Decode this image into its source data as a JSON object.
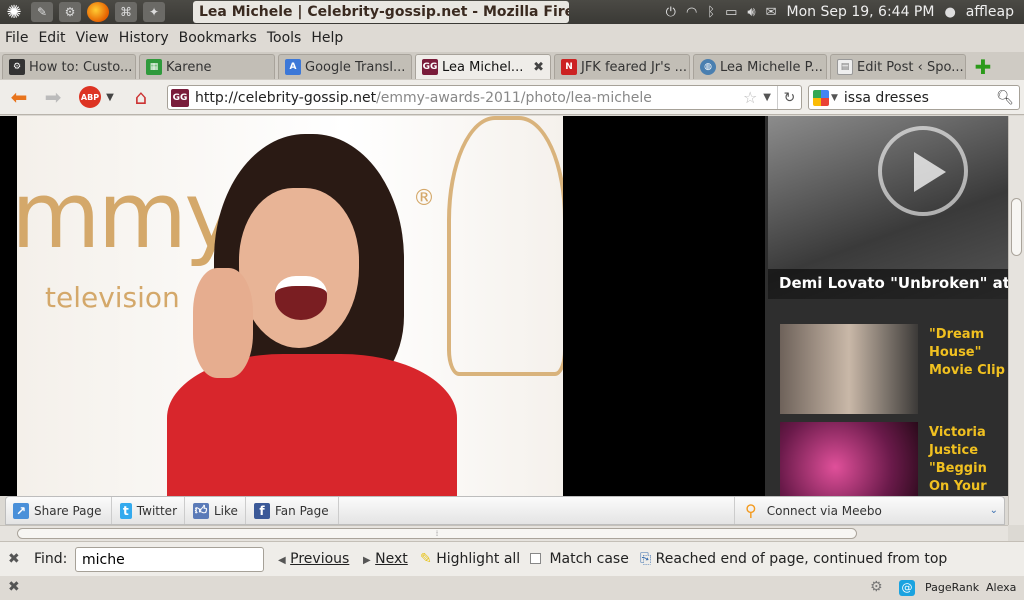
{
  "system": {
    "window_title": "Lea Michele | Celebrity-gossip.net - Mozilla Firefox",
    "clock": "Mon Sep 19,  6:44 PM",
    "user": "affleap"
  },
  "menu": [
    "File",
    "Edit",
    "View",
    "History",
    "Bookmarks",
    "Tools",
    "Help"
  ],
  "tabs": [
    {
      "label": "How to: Custo...",
      "fav": "gear-icon",
      "active": false
    },
    {
      "label": "Karene",
      "fav": "spreadsheet-icon",
      "active": false
    },
    {
      "label": "Google Transl...",
      "fav": "translate-icon",
      "active": false
    },
    {
      "label": "Lea Michel...",
      "fav": "gg-icon",
      "active": true
    },
    {
      "label": "JFK feared Jr's ...",
      "fav": "news-icon",
      "active": false
    },
    {
      "label": "Lea Michelle P...",
      "fav": "globe-icon",
      "active": false
    },
    {
      "label": "Edit Post ‹ Spo...",
      "fav": "page-icon",
      "active": false
    }
  ],
  "nav": {
    "url_host": "http://celebrity-gossip.net",
    "url_path": "/emmy-awards-2011/photo/lea-michele",
    "search_value": "issa dresses",
    "abp_label": "ABP"
  },
  "content": {
    "photo_text_1": "mmys",
    "photo_text_2": "television",
    "registered": "®",
    "video_title": "Demi Lovato \"Unbroken\" at Ham",
    "side_items": [
      {
        "title": "\"Dream House\" Movie Clip"
      },
      {
        "title": "Victoria Justice \"Beggin On Your Knees\" LA Concert Fair"
      }
    ]
  },
  "sharebar": {
    "share_page": "Share Page",
    "twitter": "Twitter",
    "like": "Like",
    "fan_page": "Fan Page",
    "meebo": "Connect via Meebo"
  },
  "findbar": {
    "label": "Find:",
    "value": "miche",
    "previous": "Previous",
    "next": "Next",
    "highlight_all": "Highlight all",
    "match_case": "Match case",
    "status": "Reached end of page, continued from top"
  },
  "statusbar": {
    "pagerank": "PageRank",
    "alexa": "Alexa"
  }
}
